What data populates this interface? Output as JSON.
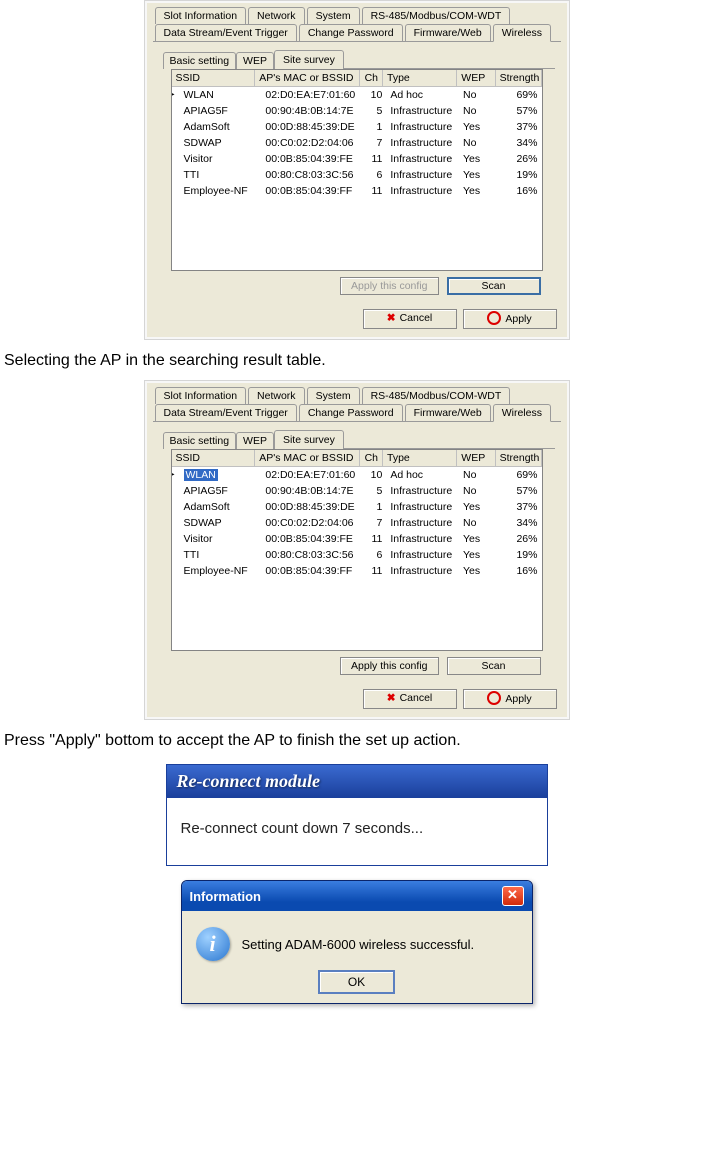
{
  "text": {
    "caption1": "Selecting the AP in the searching result table.",
    "caption2": "Press \"Apply\" bottom to accept the AP to finish the set up action."
  },
  "tabs_row1": [
    "Slot Information",
    "Network",
    "System",
    "RS-485/Modbus/COM-WDT"
  ],
  "tabs_row2": [
    "Data Stream/Event Trigger",
    "Change Password",
    "Firmware/Web",
    "Wireless"
  ],
  "active_top_tab": "Wireless",
  "sub_tabs": [
    "Basic setting",
    "WEP",
    "Site survey"
  ],
  "active_sub_tab": "Site survey",
  "columns": {
    "ssid": "SSID",
    "mac": "AP's MAC or BSSID",
    "ch": "Ch",
    "type": "Type",
    "wep": "WEP",
    "strength": "Strength"
  },
  "rows": [
    {
      "ssid": "WLAN",
      "mac": "02:D0:EA:E7:01:60",
      "ch": "10",
      "type": "Ad hoc",
      "wep": "No",
      "strength": "69%"
    },
    {
      "ssid": "APIAG5F",
      "mac": "00:90:4B:0B:14:7E",
      "ch": "5",
      "type": "Infrastructure",
      "wep": "No",
      "strength": "57%"
    },
    {
      "ssid": "AdamSoft",
      "mac": "00:0D:88:45:39:DE",
      "ch": "1",
      "type": "Infrastructure",
      "wep": "Yes",
      "strength": "37%"
    },
    {
      "ssid": "SDWAP",
      "mac": "00:C0:02:D2:04:06",
      "ch": "7",
      "type": "Infrastructure",
      "wep": "No",
      "strength": "34%"
    },
    {
      "ssid": "Visitor",
      "mac": "00:0B:85:04:39:FE",
      "ch": "11",
      "type": "Infrastructure",
      "wep": "Yes",
      "strength": "26%"
    },
    {
      "ssid": "TTI",
      "mac": "00:80:C8:03:3C:56",
      "ch": "6",
      "type": "Infrastructure",
      "wep": "Yes",
      "strength": "19%"
    },
    {
      "ssid": "Employee-NF",
      "mac": "00:0B:85:04:39:FF",
      "ch": "11",
      "type": "Infrastructure",
      "wep": "Yes",
      "strength": "16%"
    }
  ],
  "buttons": {
    "apply_config": "Apply this config",
    "scan": "Scan",
    "cancel": "Cancel",
    "apply": "Apply"
  },
  "panel1": {
    "apply_config_enabled": false,
    "selected_row": null,
    "caret_row": 0
  },
  "panel2": {
    "apply_config_enabled": true,
    "selected_row": 0,
    "caret_row": 0
  },
  "reconnect": {
    "title": "Re-connect module",
    "body": "Re-connect count down 7 seconds..."
  },
  "info": {
    "title": "Information",
    "body": "Setting ADAM-6000 wireless successful.",
    "ok": "OK"
  }
}
